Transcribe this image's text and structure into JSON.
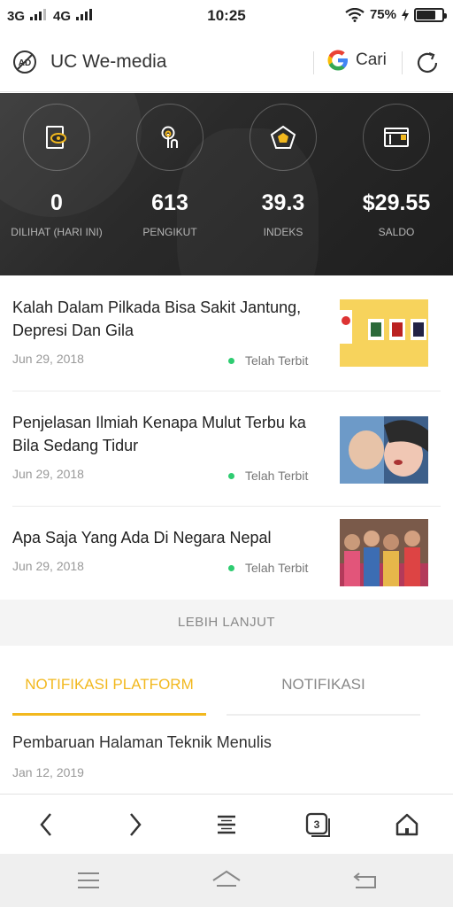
{
  "status_bar": {
    "network1": "3G",
    "network2": "4G",
    "time": "10:25",
    "battery_text": "75%",
    "battery_level": 0.75
  },
  "top_bar": {
    "title": "UC We-media",
    "search_brand": "G",
    "search_label": "Cari"
  },
  "stats": [
    {
      "value": "0",
      "label": "DILIHAT (HARI INI)",
      "icon": "eye-document-icon"
    },
    {
      "value": "613",
      "label": "PENGIKUT",
      "icon": "follower-icon"
    },
    {
      "value": "39.3",
      "label": "INDEKS",
      "icon": "pentagon-index-icon"
    },
    {
      "value": "$29.55",
      "label": "SALDO",
      "icon": "wallet-icon"
    }
  ],
  "articles": [
    {
      "title": "Kalah Dalam Pilkada Bisa Sakit Jantung, Depresi Dan Gila",
      "date": "Jun 29, 2018",
      "status": "Telah Terbit"
    },
    {
      "title": "Penjelasan Ilmiah Kenapa Mulut Terbu ka Bila Sedang Tidur",
      "date": "Jun 29, 2018",
      "status": "Telah Terbit"
    },
    {
      "title": "Apa Saja Yang Ada Di Negara Nepal",
      "date": "Jun 29, 2018",
      "status": "Telah Terbit"
    }
  ],
  "more_label": "LEBIH LANJUT",
  "tabs": [
    {
      "label": "NOTIFIKASI PLATFORM",
      "active": true
    },
    {
      "label": "NOTIFIKASI",
      "active": false
    }
  ],
  "notification": {
    "title": "Pembaruan Halaman Teknik Menulis",
    "date": "Jan 12, 2019"
  },
  "browser_nav": {
    "tab_count": "3"
  },
  "colors": {
    "accent": "#f2b81e",
    "published_dot": "#2ecc71",
    "stats_bg": "#2a2a2a"
  }
}
